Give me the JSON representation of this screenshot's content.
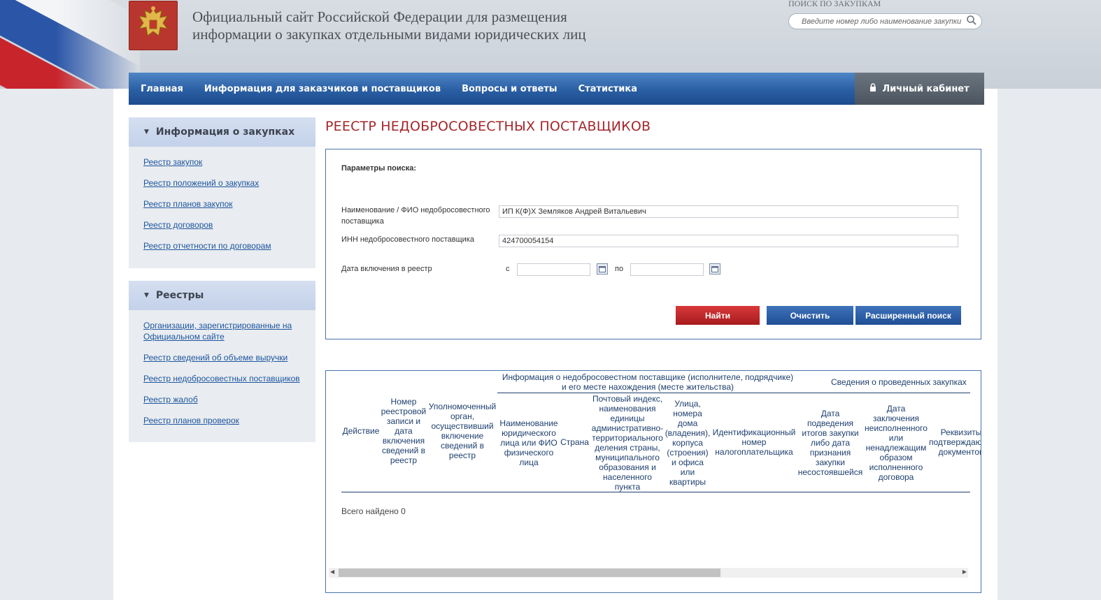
{
  "header": {
    "site_title_line1": "Официальный сайт Российской Федерации для размещения",
    "site_title_line2": "информации о закупках отдельными видами юридических лиц",
    "search_label": "ПОИСК ПО ЗАКУПКАМ",
    "search_placeholder": "Введите номер либо наименование закупки",
    "emblem_icon": "coat-of-arms-icon",
    "search_icon": "search-icon"
  },
  "nav": {
    "items": [
      {
        "label": "Главная"
      },
      {
        "label": "Информация для заказчиков и поставщиков"
      },
      {
        "label": "Вопросы и ответы"
      },
      {
        "label": "Статистика"
      }
    ],
    "cabinet_label": "Личный кабинет",
    "cabinet_icon": "lock-icon"
  },
  "sidebar": {
    "blocks": [
      {
        "title": "Информация о закупках",
        "links": [
          "Реестр закупок",
          "Реестр положений о закупках",
          "Реестр планов закупок",
          "Реестр договоров",
          "Реестр отчетности по договорам"
        ]
      },
      {
        "title": "Реестры",
        "links": [
          "Организации, зарегистрированные на Официальном сайте",
          "Реестр сведений об объеме выручки",
          "Реестр недобросовестных поставщиков",
          "Реестр жалоб",
          "Реестр планов проверок"
        ]
      }
    ]
  },
  "page_title": "РЕЕСТР НЕДОБРОСОВЕСТНЫХ ПОСТАВЩИКОВ",
  "search_form": {
    "params_label": "Параметры поиска:",
    "name_label": "Наименование / ФИО недобросовестного поставщика",
    "name_value": "ИП К(Ф)Х Земляков Андрей Витальевич",
    "inn_label": "ИНН недобросовестного поставщика",
    "inn_value": "424700054154",
    "date_label": "Дата включения в реестр",
    "date_from_label": "с",
    "date_to_label": "по",
    "date_from_value": "",
    "date_to_value": "",
    "find_button": "Найти",
    "clear_button": "Очистить",
    "advanced_button": "Расширенный поиск"
  },
  "results": {
    "group_header_supplier": "Информация о недобросовестном поставщике (исполнителе, подрядчике) и его месте нахождения (месте жительства)",
    "group_header_purchases": "Сведения о проведенных закупках",
    "columns": [
      "Действие",
      "Номер реестровой записи и дата включения сведений в реестр",
      "Уполномоченный орган, осуществивший включение сведений в реестр",
      "Наименование юридического лица или ФИО физического лица",
      "Страна",
      "Почтовый индекс, наименования единицы административно-территориального деления страны, муниципального образования и населенного пункта",
      "Улица, номера дома (владения), корпуса (строения) и офиса или квартиры",
      "Идентификационный номер налогоплательщика",
      "Дата подведения итогов закупки либо дата признания закупки несостоявшейся",
      "Дата заключения неисполненного или ненадлежащим образом исполненного договора",
      "Реквизиты подтверждающих документов"
    ],
    "total": "Всего найдено 0"
  }
}
